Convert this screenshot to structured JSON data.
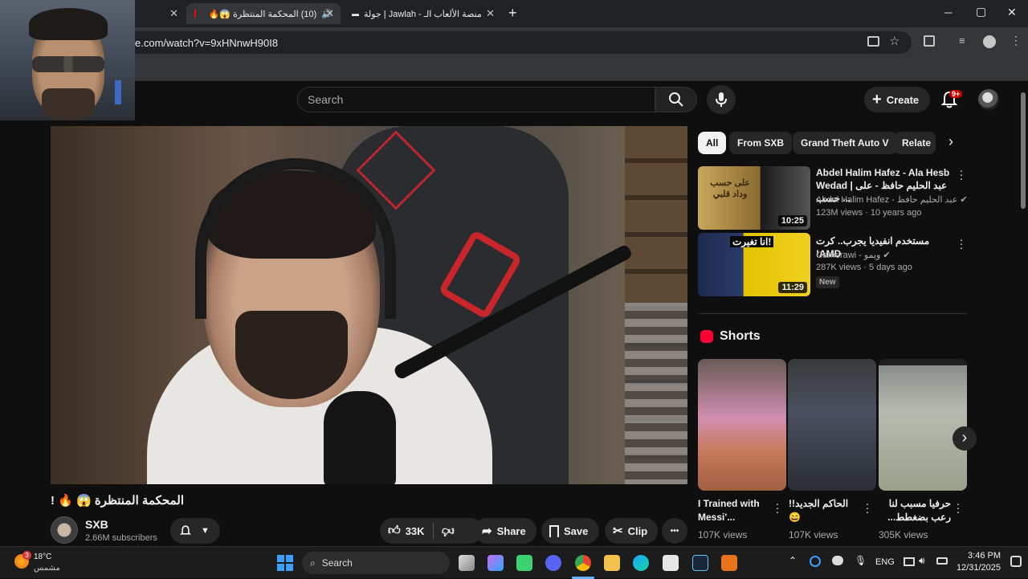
{
  "browser": {
    "tabs": [
      {
        "title": "",
        "close": "✕"
      },
      {
        "title": "(10) المحكمة المنتظرة 😱🔥",
        "close": "✕",
        "audio_icon": "speaker-icon"
      },
      {
        "title": "جولة | Jawlah - منصة الألعاب الـ",
        "close": "✕"
      }
    ],
    "new_tab": "+",
    "url": "e.com/watch?v=9xHNnwH90I8",
    "window_controls": [
      "─",
      "▢",
      "✕"
    ]
  },
  "header": {
    "search_placeholder": "Search",
    "create_label": "Create",
    "notifications_badge": "9+"
  },
  "video": {
    "title": "المحكمة المنتظرة 😱 🔥 !",
    "channel": "SXB",
    "subscribers": "2.66M subscribers",
    "likes": "33K",
    "share_label": "Share",
    "save_label": "Save",
    "clip_label": "Clip",
    "more": "•••"
  },
  "chips": [
    "All",
    "From SXB",
    "Grand Theft Auto V",
    "Relate"
  ],
  "related": [
    {
      "title": "Abdel Halim Hafez - Ala Hesb Wedad | عبد الحليم حافظ - على حسب ...",
      "channel": "Abdel Halim Hafez - عبد الحليم حافظ",
      "meta": "123M views · 10 years ago",
      "duration": "10:25",
      "thumb_text": "على حسب وداد قلبي"
    },
    {
      "title": "مستخدم انفيديا يجرب.. كرت AMD!",
      "channel": "Gamerawi - ويمو",
      "meta": "287K views · 5 days ago",
      "duration": "11:29",
      "badge": "New",
      "thumb_text": "انا تغيرت!"
    }
  ],
  "shorts": {
    "heading": "Shorts",
    "items": [
      {
        "title": "I Trained with Messi'...",
        "views": "107K views"
      },
      {
        "title": "الحاكم الجديد!! 😄",
        "views": "107K views"
      },
      {
        "title": "حرفيا مسبب لنا رعب بضغطط...",
        "views": "305K views"
      }
    ]
  },
  "taskbar": {
    "weather_temp": "18°C",
    "weather_desc": "مشمس",
    "weather_badge": "3",
    "search_label": "Search",
    "lang": "ENG",
    "time": "3:46 PM",
    "date": "12/31/2025"
  }
}
